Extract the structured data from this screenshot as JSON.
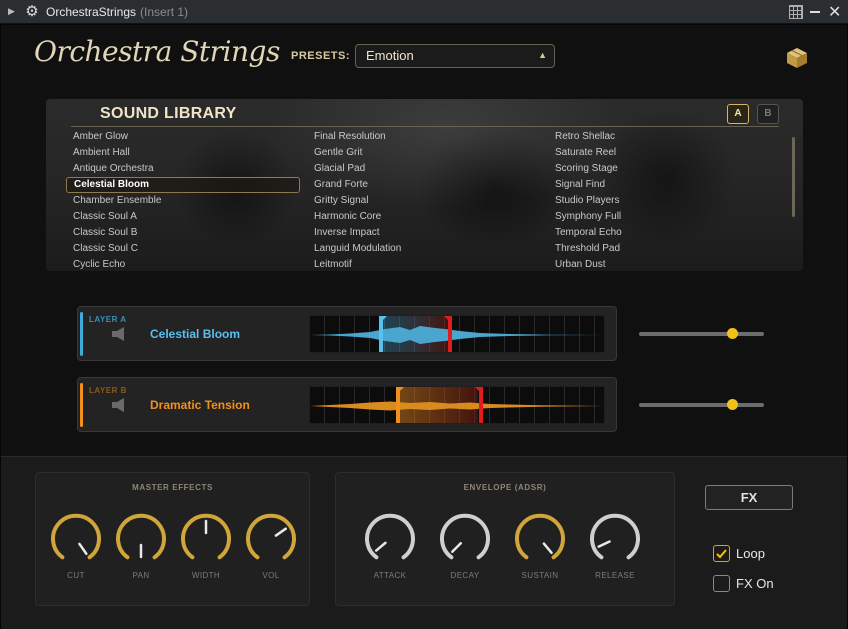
{
  "titlebar": {
    "title": "OrchestraStrings",
    "insert": "(Insert 1)"
  },
  "header": {
    "brand": "Orchestra Strings",
    "presets_label": "PRESETS:",
    "preset_value": "Emotion"
  },
  "library": {
    "title": "SOUND LIBRARY",
    "tab_a": "A",
    "tab_b": "B",
    "col1": [
      "Amber Glow",
      "Ambient Hall",
      "Antique Orchestra",
      "Celestial Bloom",
      "Chamber Ensemble",
      "Classic Soul A",
      "Classic Soul B",
      "Classic Soul C",
      "Cyclic Echo"
    ],
    "col2": [
      "Final Resolution",
      "Gentle Grit",
      "Glacial Pad",
      "Grand Forte",
      "Gritty Signal",
      "Harmonic Core",
      "Inverse Impact",
      "Languid Modulation",
      "Leitmotif"
    ],
    "col3": [
      "Retro Shellac",
      "Saturate Reel",
      "Scoring Stage",
      "Signal Find",
      "Studio Players",
      "Symphony Full",
      "Temporal Echo",
      "Threshold Pad",
      "Urban Dust"
    ],
    "selected": "Celestial Bloom"
  },
  "layers": [
    {
      "tag": "LAYER A",
      "name": "Celestial Bloom",
      "color": "#3fa9d9",
      "volume": 0.74
    },
    {
      "tag": "LAYER B",
      "name": "Dramatic Tension",
      "color": "#f2901e",
      "volume": 0.74
    }
  ],
  "master_effects": {
    "title": "MASTER EFFECTS",
    "knobs": [
      {
        "label": "CUT",
        "accent": true
      },
      {
        "label": "PAN",
        "accent": true
      },
      {
        "label": "WIDTH",
        "accent": true
      },
      {
        "label": "VOL",
        "accent": true
      }
    ]
  },
  "envelope": {
    "title": "ENVELOPE (ADSR)",
    "knobs": [
      {
        "label": "ATTACK",
        "accent": false
      },
      {
        "label": "DECAY",
        "accent": false
      },
      {
        "label": "SUSTAIN",
        "accent": true
      },
      {
        "label": "RELEASE",
        "accent": false
      }
    ]
  },
  "fx": {
    "button": "FX",
    "loop_label": "Loop",
    "loop_checked": true,
    "fxon_label": "FX On",
    "fxon_checked": false
  },
  "colors": {
    "gold": "#d0a53a",
    "accent_a": "#3fa9d9",
    "accent_b": "#f2901e",
    "knob_dot": "#f1c11a"
  }
}
